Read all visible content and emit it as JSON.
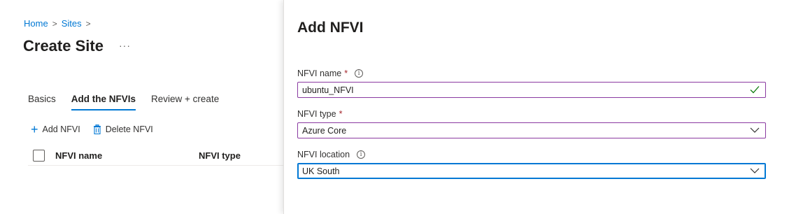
{
  "breadcrumb": {
    "home": "Home",
    "sites": "Sites",
    "sep": ">"
  },
  "page": {
    "title": "Create Site",
    "more": "···"
  },
  "tabs": [
    {
      "label": "Basics",
      "active": false
    },
    {
      "label": "Add the NFVIs",
      "active": true
    },
    {
      "label": "Review + create",
      "active": false
    }
  ],
  "toolbar": {
    "add_label": "Add NFVI",
    "delete_label": "Delete NFVI"
  },
  "table": {
    "columns": [
      "NFVI name",
      "NFVI type"
    ]
  },
  "panel": {
    "title": "Add NFVI",
    "name_label": "NFVI name",
    "name_value": "ubuntu_NFVI",
    "type_label": "NFVI type",
    "type_value": "Azure Core",
    "location_label": "NFVI location",
    "location_value": "UK South",
    "required_mark": "*",
    "info_glyph": "i"
  },
  "colors": {
    "accent": "#0078d4",
    "required": "#a4262c",
    "valid": "#107c10",
    "field_border": "#8a3aa1"
  }
}
